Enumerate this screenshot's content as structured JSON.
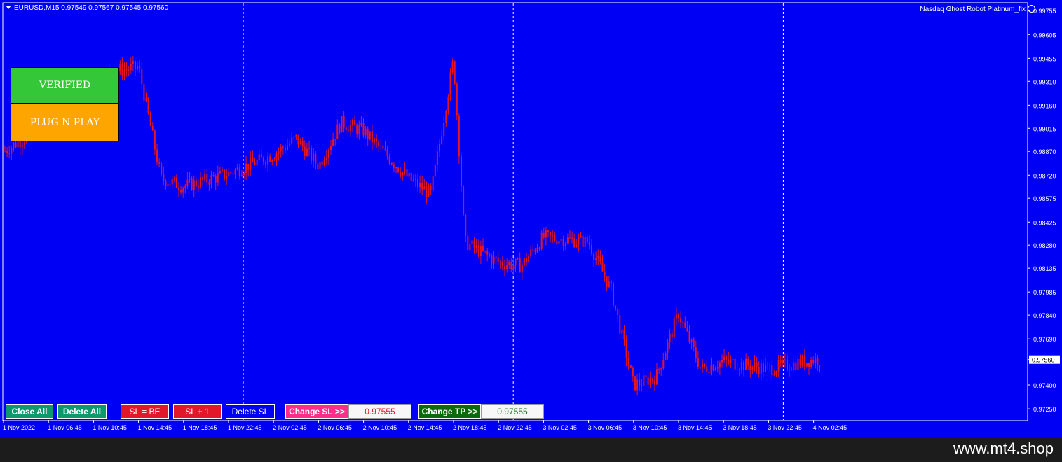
{
  "header": {
    "symbol_info": "EURUSD,M15  0.97549 0.97567 0.97545 0.97560",
    "ea_name": "Nasdaq Ghost Robot Platinum_fix"
  },
  "badges": {
    "verified": "VERIFIED",
    "plug": "PLUG N PLAY"
  },
  "buttons": {
    "close_all": "Close All",
    "delete_all": "Delete All",
    "sl_be": "SL = BE",
    "sl_plus1": "SL + 1",
    "delete_sl": "Delete SL",
    "change_sl": "Change SL >>",
    "sl_value": "0.97555",
    "change_tp": "Change TP >>",
    "tp_value": "0.97555"
  },
  "colors": {
    "background": "#0000f5",
    "candle": "#e8151e",
    "close_all": "#0a9a6b",
    "sl_red": "#e0182a",
    "change_sl": "#ff2d8a",
    "change_tp": "#0b6b0b"
  },
  "chart_data": {
    "type": "line",
    "title": "",
    "symbol": "EURUSD",
    "timeframe": "M15",
    "current_price": "0.97560",
    "y_ticks": [
      "0.99755",
      "0.99605",
      "0.99455",
      "0.99310",
      "0.99160",
      "0.99015",
      "0.98870",
      "0.98720",
      "0.98575",
      "0.98425",
      "0.98280",
      "0.98135",
      "0.97985",
      "0.97840",
      "0.97690",
      "0.97560",
      "0.97400",
      "0.97250"
    ],
    "ylim": [
      0.9718,
      0.998
    ],
    "x_ticks": [
      "1 Nov 2022",
      "1 Nov 06:45",
      "1 Nov 10:45",
      "1 Nov 14:45",
      "1 Nov 18:45",
      "1 Nov 22:45",
      "2 Nov 02:45",
      "2 Nov 06:45",
      "2 Nov 10:45",
      "2 Nov 14:45",
      "2 Nov 18:45",
      "2 Nov 22:45",
      "3 Nov 02:45",
      "3 Nov 06:45",
      "3 Nov 10:45",
      "3 Nov 14:45",
      "3 Nov 18:45",
      "3 Nov 22:45",
      "4 Nov 02:45"
    ],
    "day_separators": [
      "1 Nov 22:45",
      "2 Nov 22:45",
      "3 Nov 22:45"
    ],
    "grid": false,
    "price_path": [
      {
        "x": "1 Nov 2022",
        "y": 0.9887
      },
      {
        "x": "1 Nov 06:45",
        "y": 0.9905
      },
      {
        "x": "1 Nov 10:45",
        "y": 0.9935
      },
      {
        "x": "1 Nov 14:45",
        "y": 0.994
      },
      {
        "x": "1 Nov 16:45",
        "y": 0.987
      },
      {
        "x": "1 Nov 18:45",
        "y": 0.9865
      },
      {
        "x": "1 Nov 22:45",
        "y": 0.9873
      },
      {
        "x": "2 Nov 02:45",
        "y": 0.9885
      },
      {
        "x": "2 Nov 04:45",
        "y": 0.9895
      },
      {
        "x": "2 Nov 06:45",
        "y": 0.9878
      },
      {
        "x": "2 Nov 08:45",
        "y": 0.9905
      },
      {
        "x": "2 Nov 10:45",
        "y": 0.99
      },
      {
        "x": "2 Nov 14:45",
        "y": 0.987
      },
      {
        "x": "2 Nov 16:45",
        "y": 0.986
      },
      {
        "x": "2 Nov 18:45",
        "y": 0.9945
      },
      {
        "x": "2 Nov 19:45",
        "y": 0.983
      },
      {
        "x": "2 Nov 22:45",
        "y": 0.9817
      },
      {
        "x": "3 Nov 00:45",
        "y": 0.9815
      },
      {
        "x": "3 Nov 02:45",
        "y": 0.9833
      },
      {
        "x": "3 Nov 06:45",
        "y": 0.983
      },
      {
        "x": "3 Nov 08:45",
        "y": 0.98
      },
      {
        "x": "3 Nov 10:45",
        "y": 0.974
      },
      {
        "x": "3 Nov 12:45",
        "y": 0.9745
      },
      {
        "x": "3 Nov 14:45",
        "y": 0.9785
      },
      {
        "x": "3 Nov 16:45",
        "y": 0.975
      },
      {
        "x": "3 Nov 18:45",
        "y": 0.9755
      },
      {
        "x": "3 Nov 22:45",
        "y": 0.975
      },
      {
        "x": "4 Nov 02:45",
        "y": 0.9756
      }
    ]
  },
  "footer": {
    "site": "www.mt4.shop"
  }
}
